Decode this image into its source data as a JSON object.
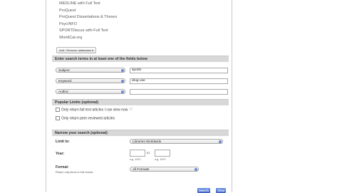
{
  "databases": [
    "MEDLINE with Full Text",
    "ProQuest",
    "ProQuest Dissertations & Theses",
    "PsycINFO",
    "SPORTDiscus with Full Text",
    "WorldCat.org"
  ],
  "add_databases_label": "Add / Remove databases",
  "search_section": {
    "title": "Enter search terms in at least one of the fields below",
    "fields": [
      {
        "type": "Subject:",
        "value": "sports"
      },
      {
        "type": "Keyword:",
        "value": "drug use"
      },
      {
        "type": "Author:",
        "value": ""
      }
    ]
  },
  "limits_section": {
    "title": "Popular Limits (optional)",
    "options": [
      "Only return full text articles I can view now",
      "Only return peer-reviewed articles"
    ]
  },
  "narrow_section": {
    "title": "Narrow your search (optional)",
    "limit_to_label": "Limit to:",
    "limit_to_value": "Libraries Worldwide",
    "year_label": "Year:",
    "year_to": "to:",
    "year_hint": "e.g. 1971",
    "format_label": "Format:",
    "format_sub": "Return only items in this format",
    "format_value": "All Formats"
  },
  "buttons": {
    "search": "Search",
    "clear": "Clear"
  }
}
